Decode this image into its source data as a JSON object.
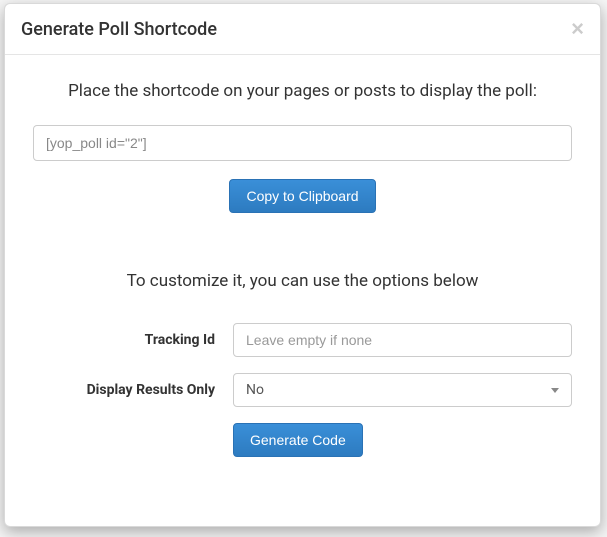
{
  "modal": {
    "title": "Generate Poll Shortcode",
    "close_label": "×"
  },
  "intro": "Place the shortcode on your pages or posts to display the poll:",
  "shortcode": {
    "value": "[yop_poll id=\"2\"]"
  },
  "copy_button": "Copy to Clipboard",
  "customize_heading": "To customize it, you can use the options below",
  "form": {
    "tracking": {
      "label": "Tracking Id",
      "placeholder": "Leave empty if none",
      "value": ""
    },
    "display_results": {
      "label": "Display Results Only",
      "value": "No"
    }
  },
  "generate_button": "Generate Code"
}
